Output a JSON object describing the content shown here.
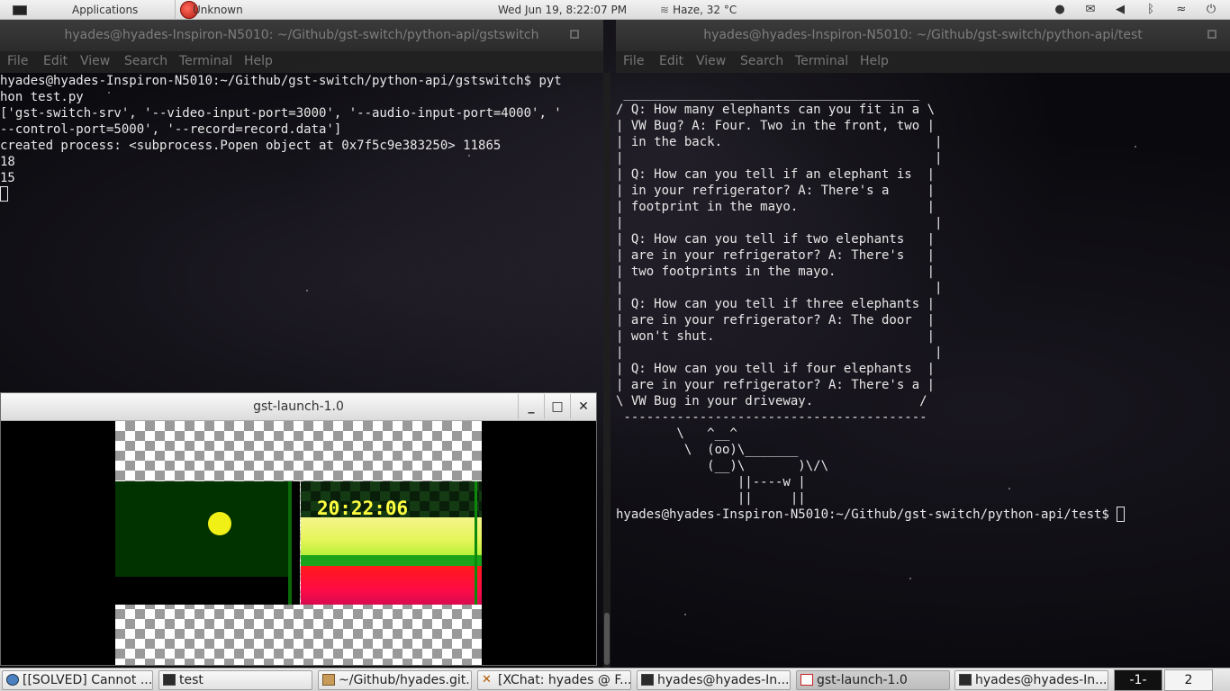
{
  "top_panel": {
    "applications_label": "Applications",
    "unknown_label": "Unknown",
    "clock": "Wed Jun 19,  8:22:07 PM",
    "weather": "Haze, 32 °C",
    "icons": [
      "chat-icon",
      "mail-icon",
      "volume-icon",
      "bluetooth-icon",
      "wifi-icon",
      "power-icon"
    ]
  },
  "terminal_left": {
    "title": "hyades@hyades-Inspiron-N5010: ~/Github/gst-switch/python-api/gstswitch",
    "menu": [
      "File",
      "Edit",
      "View",
      "Search",
      "Terminal",
      "Help"
    ],
    "output": "hyades@hyades-Inspiron-N5010:~/Github/gst-switch/python-api/gstswitch$ pyt\nhon test.py\n['gst-switch-srv', '--video-input-port=3000', '--audio-input-port=4000', '\n--control-port=5000', '--record=record.data']\ncreated process: <subprocess.Popen object at 0x7f5c9e383250> 11865\n18\n15"
  },
  "terminal_right": {
    "title": "hyades@hyades-Inspiron-N5010: ~/Github/gst-switch/python-api/test",
    "menu": [
      "File",
      "Edit",
      "View",
      "Search",
      "Terminal",
      "Help"
    ],
    "output": " _______________________________________\n/ Q: How many elephants can you fit in a \\\n| VW Bug? A: Four. Two in the front, two |\n| in the back.                            |\n|                                         |\n| Q: How can you tell if an elephant is  |\n| in your refrigerator? A: There's a     |\n| footprint in the mayo.                 |\n|                                         |\n| Q: How can you tell if two elephants   |\n| are in your refrigerator? A: There's   |\n| two footprints in the mayo.            |\n|                                         |\n| Q: How can you tell if three elephants |\n| are in your refrigerator? A: The door  |\n| won't shut.                            |\n|                                         |\n| Q: How can you tell if four elephants  |\n| are in your refrigerator? A: There's a |\n\\ VW Bug in your driveway.              /\n ----------------------------------------\n        \\   ^__^\n         \\  (oo)\\_______\n            (__)\\       )\\/\\\n                ||----w |\n                ||     ||",
    "prompt": "hyades@hyades-Inspiron-N5010:~/Github/gst-switch/python-api/test$ "
  },
  "gst_window": {
    "title": "gst-launch-1.0",
    "minimize_label": "_",
    "maximize_label": "□",
    "close_label": "✕",
    "timestamp": "20:22:06"
  },
  "taskbar": {
    "tasks": [
      {
        "label": "[[SOLVED] Cannot ...",
        "icon": "globe-icon"
      },
      {
        "label": "test",
        "icon": "terminal-icon"
      },
      {
        "label": "~/Github/hyades.git...",
        "icon": "folder-icon"
      },
      {
        "label": "[XChat: hyades @ F...",
        "icon": "xchat-icon"
      },
      {
        "label": "hyades@hyades-In...",
        "icon": "terminal-icon"
      },
      {
        "label": "gst-launch-1.0",
        "icon": "gst-icon"
      },
      {
        "label": "hyades@hyades-In...",
        "icon": "terminal-icon"
      }
    ],
    "workspaces": [
      "-1-",
      "2"
    ]
  }
}
